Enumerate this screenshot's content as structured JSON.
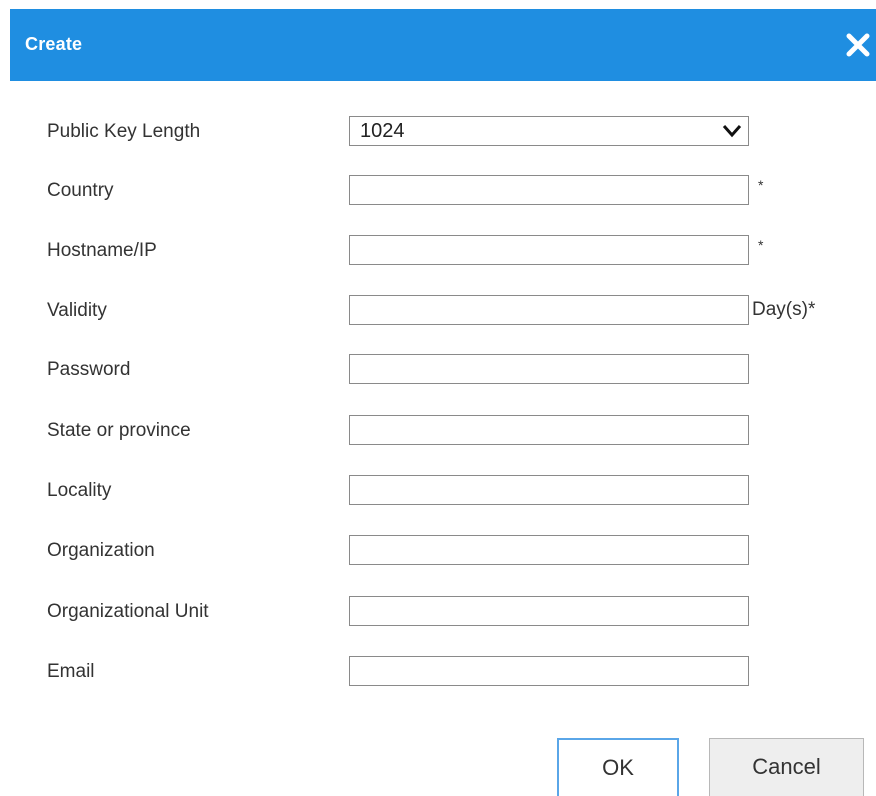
{
  "dialog": {
    "title": "Create",
    "close_icon": "close-icon"
  },
  "form": {
    "public_key_length": {
      "label": "Public Key Length",
      "value": "1024",
      "icon": "chevron-down-icon"
    },
    "country": {
      "label": "Country",
      "value": "",
      "suffix": "*"
    },
    "hostname": {
      "label": "Hostname/IP",
      "value": "",
      "suffix": "*"
    },
    "validity": {
      "label": "Validity",
      "value": "",
      "suffix": "Day(s)*"
    },
    "password": {
      "label": "Password",
      "value": ""
    },
    "state": {
      "label": "State or province",
      "value": ""
    },
    "locality": {
      "label": "Locality",
      "value": ""
    },
    "organization": {
      "label": "Organization",
      "value": ""
    },
    "org_unit": {
      "label": "Organizational Unit",
      "value": ""
    },
    "email": {
      "label": "Email",
      "value": ""
    }
  },
  "buttons": {
    "ok": "OK",
    "cancel": "Cancel"
  },
  "colors": {
    "titlebar": "#1f8ee1",
    "ok_border": "#5aa6e8"
  }
}
